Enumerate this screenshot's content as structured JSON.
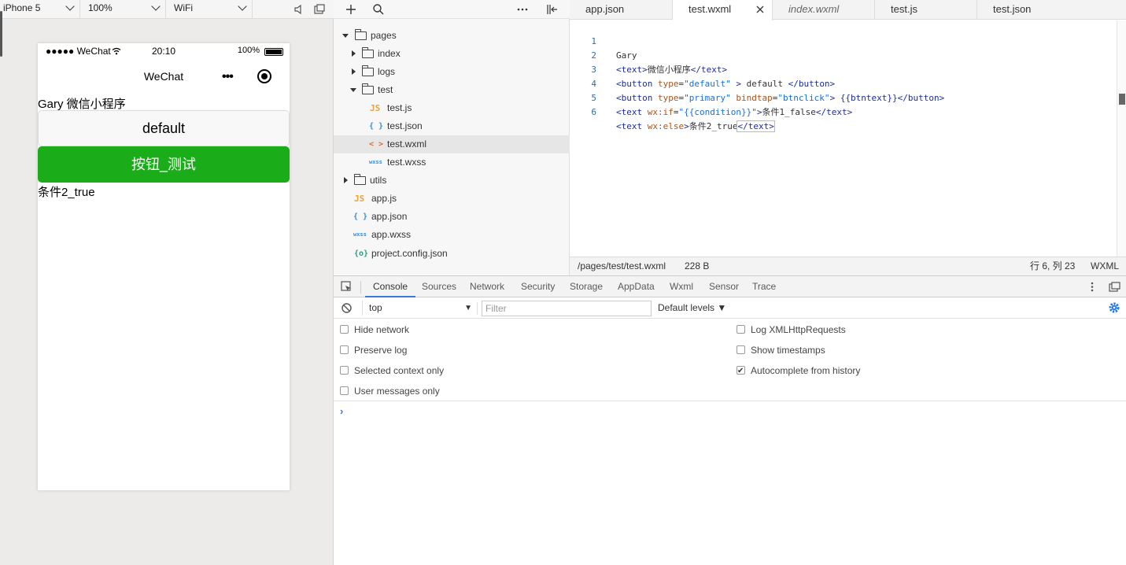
{
  "simulator": {
    "device": "iPhone 5",
    "zoom": "100%",
    "network": "WiFi",
    "status": {
      "carrier": "●●●●● WeChat",
      "time": "20:10",
      "battery": "100%"
    },
    "nav_title": "WeChat",
    "nav_more": "•••",
    "text1": "Gary 微信小程序",
    "button_default": "default",
    "button_primary": "按钮_测试",
    "text2": "条件2_true",
    "colors": {
      "primary_button": "#1aad19"
    }
  },
  "tree": {
    "items": [
      {
        "label": "pages",
        "type": "folder",
        "expanded": true
      },
      {
        "label": "index",
        "type": "folder",
        "expanded": false
      },
      {
        "label": "logs",
        "type": "folder",
        "expanded": false
      },
      {
        "label": "test",
        "type": "folder",
        "expanded": true
      },
      {
        "label": "test.js",
        "type": "js",
        "icon": "JS"
      },
      {
        "label": "test.json",
        "type": "json",
        "icon": "{ }"
      },
      {
        "label": "test.wxml",
        "type": "wxml",
        "icon": "< >",
        "selected": true
      },
      {
        "label": "test.wxss",
        "type": "wxss",
        "icon": "wxss"
      },
      {
        "label": "utils",
        "type": "folder",
        "expanded": false
      },
      {
        "label": "app.js",
        "type": "js",
        "icon": "JS"
      },
      {
        "label": "app.json",
        "type": "json",
        "icon": "{ }"
      },
      {
        "label": "app.wxss",
        "type": "wxss",
        "icon": "wxss"
      },
      {
        "label": "project.config.json",
        "type": "config",
        "icon": "{o}"
      }
    ]
  },
  "editor": {
    "tabs": [
      "app.json",
      "test.wxml",
      "index.wxml",
      "test.js",
      "test.json"
    ],
    "line_numbers": [
      "1",
      "2",
      "3",
      "4",
      "5",
      "6"
    ],
    "code": {
      "l1": "Gary",
      "l2_open": "<text>",
      "l2_text": "微信小程序",
      "l2_close": "</text>",
      "l3_open": "<button ",
      "l3_attr": "type",
      "l3_eq": "=",
      "l3_val": "\"default\"",
      "l3_gt": " > ",
      "l3_text": "default ",
      "l3_close": "</button>",
      "l4_open": "<button ",
      "l4_attr1": "type",
      "l4_eq1": "=",
      "l4_val1": "\"primary\"",
      "l4_sp": " ",
      "l4_attr2": "bindtap",
      "l4_eq2": "=",
      "l4_val2": "\"btnclick\"",
      "l4_gt": "> ",
      "l4_text": "{{btntext}}",
      "l4_close": "</button>",
      "l5_open": "<text ",
      "l5_attr": "wx:if",
      "l5_eq": "=",
      "l5_val": "\"{{condition}}\"",
      "l5_gt": ">",
      "l5_text": "条件1_false",
      "l5_close": "</text>",
      "l6_open": "<text ",
      "l6_attr": "wx:else",
      "l6_gt": ">",
      "l6_text": "条件2_true",
      "l6_close": "</text>"
    },
    "status": {
      "path": "/pages/test/test.wxml",
      "size": "228 B",
      "position": "行 6, 列 23",
      "lang": "WXML"
    }
  },
  "devtools": {
    "tabs": [
      "Console",
      "Sources",
      "Network",
      "Security",
      "Storage",
      "AppData",
      "Wxml",
      "Sensor",
      "Trace"
    ],
    "context": "top",
    "filter_placeholder": "Filter",
    "levels": "Default levels ▼",
    "options_left": [
      "Hide network",
      "Preserve log",
      "Selected context only",
      "User messages only"
    ],
    "options_right": [
      "Log XMLHttpRequests",
      "Show timestamps",
      "Autocomplete from history"
    ],
    "autocomplete_checked": true,
    "prompt": "›"
  }
}
